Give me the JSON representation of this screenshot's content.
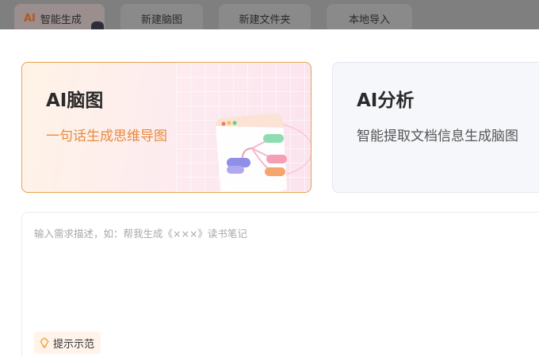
{
  "tabs": [
    {
      "badge": "AI",
      "label": "智能生成"
    },
    {
      "label": "新建脑图"
    },
    {
      "label": "新建文件夹"
    },
    {
      "label": "本地导入"
    }
  ],
  "cards": [
    {
      "title": "AI脑图",
      "subtitle": "一句话生成思维导图"
    },
    {
      "title": "AI分析",
      "subtitle": "智能提取文档信息生成脑图"
    }
  ],
  "input": {
    "placeholder": "输入需求描述，如：帮我生成《×××》读书笔记",
    "value": ""
  },
  "hint_button": {
    "label": "提示示范",
    "icon": "lightbulb-icon"
  },
  "colors": {
    "accent": "#e98a3c",
    "card_border": "#e8a04e",
    "overlay": "#7f7f7f"
  }
}
